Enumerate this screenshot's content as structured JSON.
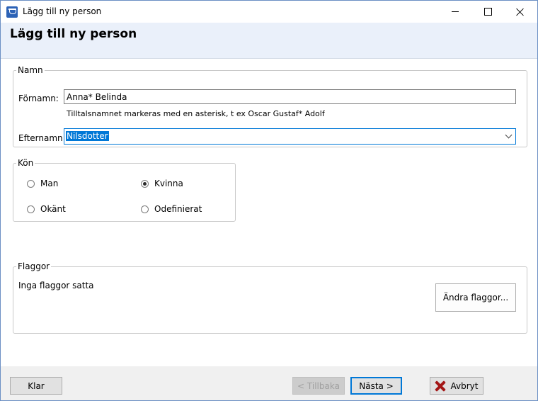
{
  "window": {
    "title": "Lägg till ny person"
  },
  "header": {
    "title": "Lägg till ny person"
  },
  "namn": {
    "legend": "Namn",
    "fornamn_label": "Förnamn:",
    "fornamn_value": "Anna* Belinda",
    "hint": "Tilltalsnamnet markeras med en asterisk, t ex  Oscar Gustaf* Adolf",
    "efternamn_label": "Efternamn:",
    "efternamn_value": "Nilsdotter"
  },
  "kon": {
    "legend": "Kön",
    "options": [
      {
        "label": "Man",
        "checked": false
      },
      {
        "label": "Kvinna",
        "checked": true
      },
      {
        "label": "Okänt",
        "checked": false
      },
      {
        "label": "Odefinierat",
        "checked": false
      }
    ]
  },
  "flaggor": {
    "legend": "Flaggor",
    "status": "Inga flaggor satta",
    "edit_button": "Ändra flaggor..."
  },
  "footer": {
    "klar": "Klar",
    "tillbaka": "< Tillbaka",
    "nasta": "Nästa >",
    "avbryt": "Avbryt"
  },
  "icons": {
    "app": "person-tree-icon",
    "cancel": "red-x-icon"
  },
  "colors": {
    "accent": "#0078d7",
    "header_bg": "#eaf0fa",
    "cancel_icon": "#a31616"
  }
}
